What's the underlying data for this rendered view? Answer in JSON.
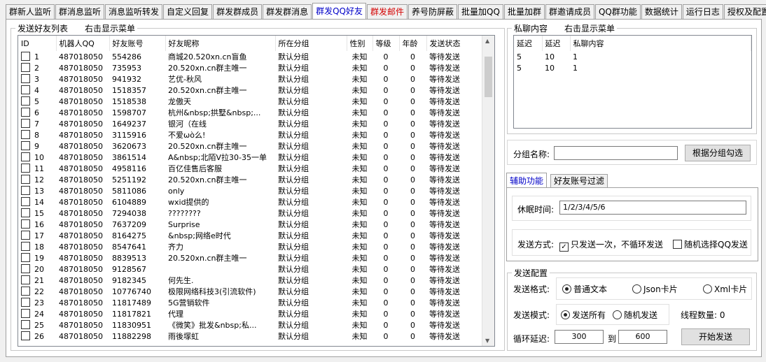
{
  "tabs": [
    {
      "label": "群新人监听"
    },
    {
      "label": "群消息监听"
    },
    {
      "label": "消息监听转发"
    },
    {
      "label": "自定义回复"
    },
    {
      "label": "群发群成员"
    },
    {
      "label": "群发群消息"
    },
    {
      "label": "群发QQ好友",
      "active": true
    },
    {
      "label": "群发邮件",
      "mail": true
    },
    {
      "label": "养号防屏蔽"
    },
    {
      "label": "批量加QQ"
    },
    {
      "label": "批量加群"
    },
    {
      "label": "群邀请成员"
    },
    {
      "label": "QQ群功能"
    },
    {
      "label": "数据统计"
    },
    {
      "label": "运行日志"
    },
    {
      "label": "授权及配置"
    }
  ],
  "friends": {
    "legend": "发送好友列表",
    "menu_hint": "右击显示菜单",
    "columns": [
      "ID",
      "机器人QQ",
      "好友账号",
      "好友昵称",
      "所在分组",
      "性别",
      "等级",
      "年龄",
      "发送状态"
    ],
    "rows": [
      [
        "1",
        "487018050",
        "554286",
        "商城20.520xn.cn盲鱼",
        "默认分组",
        "未知",
        "0",
        "0",
        "等待发送"
      ],
      [
        "2",
        "487018050",
        "735953",
        "20.520xn.cn群主唯一",
        "默认分组",
        "未知",
        "0",
        "0",
        "等待发送"
      ],
      [
        "3",
        "487018050",
        "941932",
        "艺优-秋风",
        "默认分组",
        "未知",
        "0",
        "0",
        "等待发送"
      ],
      [
        "4",
        "487018050",
        "1518357",
        "20.520xn.cn群主唯一",
        "默认分组",
        "未知",
        "0",
        "0",
        "等待发送"
      ],
      [
        "5",
        "487018050",
        "1518538",
        "龙傲天",
        "默认分组",
        "未知",
        "0",
        "0",
        "等待发送"
      ],
      [
        "6",
        "487018050",
        "1598707",
        "杭州&nbsp;拱墅&nbsp;...",
        "默认分组",
        "未知",
        "0",
        "0",
        "等待发送"
      ],
      [
        "7",
        "487018050",
        "1649237",
        "银河（在线",
        "默认分组",
        "未知",
        "0",
        "0",
        "等待发送"
      ],
      [
        "8",
        "487018050",
        "3115916",
        "不爱ωò么!",
        "默认分组",
        "未知",
        "0",
        "0",
        "等待发送"
      ],
      [
        "9",
        "487018050",
        "3620673",
        "20.520xn.cn群主唯一",
        "默认分组",
        "未知",
        "0",
        "0",
        "等待发送"
      ],
      [
        "10",
        "487018050",
        "3861514",
        "A&nbsp;北陌V拉30-35一单",
        "默认分组",
        "未知",
        "0",
        "0",
        "等待发送"
      ],
      [
        "11",
        "487018050",
        "4958116",
        "百亿佳售后客服",
        "默认分组",
        "未知",
        "0",
        "0",
        "等待发送"
      ],
      [
        "12",
        "487018050",
        "5251192",
        "20.520xn.cn群主唯一",
        "默认分组",
        "未知",
        "0",
        "0",
        "等待发送"
      ],
      [
        "13",
        "487018050",
        "5811086",
        "only",
        "默认分组",
        "未知",
        "0",
        "0",
        "等待发送"
      ],
      [
        "14",
        "487018050",
        "6104889",
        "wxid提供的",
        "默认分组",
        "未知",
        "0",
        "0",
        "等待发送"
      ],
      [
        "15",
        "487018050",
        "7294038",
        "????????",
        "默认分组",
        "未知",
        "0",
        "0",
        "等待发送"
      ],
      [
        "16",
        "487018050",
        "7637209",
        "Surprise",
        "默认分组",
        "未知",
        "0",
        "0",
        "等待发送"
      ],
      [
        "17",
        "487018050",
        "8164275",
        "&nbsp;网络e时代",
        "默认分组",
        "未知",
        "0",
        "0",
        "等待发送"
      ],
      [
        "18",
        "487018050",
        "8547641",
        "齐力",
        "默认分组",
        "未知",
        "0",
        "0",
        "等待发送"
      ],
      [
        "19",
        "487018050",
        "8839513",
        "20.520xn.cn群主唯一",
        "默认分组",
        "未知",
        "0",
        "0",
        "等待发送"
      ],
      [
        "20",
        "487018050",
        "9128567",
        "",
        "默认分组",
        "未知",
        "0",
        "0",
        "等待发送"
      ],
      [
        "21",
        "487018050",
        "9182345",
        "何先生.",
        "默认分组",
        "未知",
        "0",
        "0",
        "等待发送"
      ],
      [
        "22",
        "487018050",
        "10776740",
        "极限网络科技3(引流软件)",
        "默认分组",
        "未知",
        "0",
        "0",
        "等待发送"
      ],
      [
        "23",
        "487018050",
        "11817489",
        "5G营销软件",
        "默认分组",
        "未知",
        "0",
        "0",
        "等待发送"
      ],
      [
        "24",
        "487018050",
        "11817821",
        "代理",
        "默认分组",
        "未知",
        "0",
        "0",
        "等待发送"
      ],
      [
        "25",
        "487018050",
        "11830951",
        "《微笑》批发&nbsp;私...",
        "默认分组",
        "未知",
        "0",
        "0",
        "等待发送"
      ],
      [
        "26",
        "487018050",
        "11882298",
        "雨後塜虹",
        "默认分组",
        "未知",
        "0",
        "0",
        "等待发送"
      ]
    ]
  },
  "private": {
    "legend": "私聊内容",
    "menu_hint": "右击显示菜单",
    "columns": [
      "延迟",
      "延迟",
      "私聊内容"
    ],
    "rows": [
      [
        "5",
        "10",
        "1"
      ],
      [
        "5",
        "10",
        "1"
      ]
    ]
  },
  "group": {
    "label": "分组名称:",
    "value": "",
    "button": "根据分组勾选"
  },
  "subtabs": [
    {
      "label": "辅助功能",
      "active": true
    },
    {
      "label": "好友账号过滤"
    }
  ],
  "aux": {
    "sleep_label": "休眠时间:",
    "sleep_value": "1/2/3/4/5/6",
    "send_mode_label": "发送方式:",
    "once_label": "只发送一次，不循环发送",
    "random_label": "随机选择QQ发送"
  },
  "config": {
    "legend": "发送配置",
    "format_label": "发送格式:",
    "format_options": [
      "普通文本",
      "Json卡片",
      "Xml卡片"
    ],
    "mode_label": "发送模式:",
    "mode_options": [
      "发送所有",
      "随机发送"
    ],
    "thread_label": "线程数量: 0",
    "loop_label": "循环延迟:",
    "loop_from": "300",
    "to_label": "到",
    "loop_to": "600",
    "start_button": "开始发送"
  }
}
